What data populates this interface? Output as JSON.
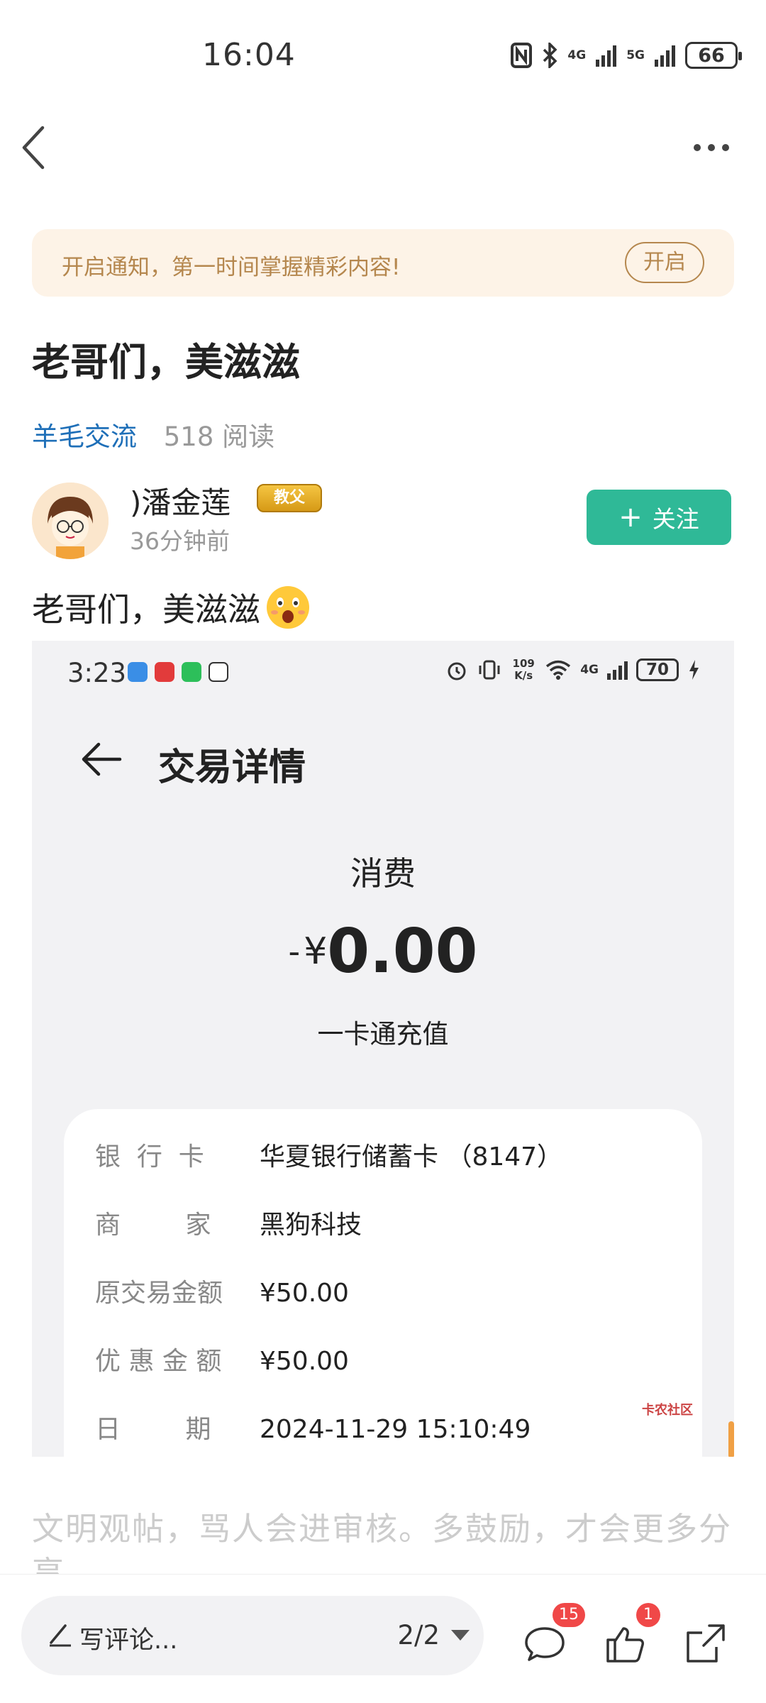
{
  "status_bar": {
    "time": "16:04",
    "net1": "4G",
    "net2": "5G",
    "battery": "66"
  },
  "notify": {
    "text": "开启通知，第一时间掌握精彩内容!",
    "button": "开启"
  },
  "post": {
    "title": "老哥们，美滋滋",
    "category": "羊毛交流",
    "reads": "518 阅读",
    "author": {
      "name": ")潘金莲",
      "badge": "教父",
      "time": "36分钟前",
      "follow_label": "关注"
    },
    "body": "老哥们，美滋滋"
  },
  "screenshot": {
    "status": {
      "time": "3:23",
      "speed": "109 K/s",
      "net": "4G",
      "battery": "70"
    },
    "title": "交易详情",
    "kind": "消费",
    "amount_sign": "-",
    "currency": "¥",
    "amount": "0.00",
    "subtitle": "一卡通充值",
    "details": [
      {
        "key": "银  行  卡",
        "value": "华夏银行储蓄卡 （8147）"
      },
      {
        "key": "商        家",
        "value": "黑狗科技"
      },
      {
        "key": "原交易金额",
        "value": "¥50.00"
      },
      {
        "key": "优 惠 金 额",
        "value": "¥50.00"
      },
      {
        "key": "日        期",
        "value": "2024-11-29 15:10:49"
      }
    ],
    "watermark": "卡农社区"
  },
  "hint": "文明观帖，骂人会进审核。多鼓励，才会更多分享",
  "bottom": {
    "comment_placeholder": "写评论...",
    "pager": "2/2",
    "comments_count": "15",
    "likes_count": "1"
  }
}
